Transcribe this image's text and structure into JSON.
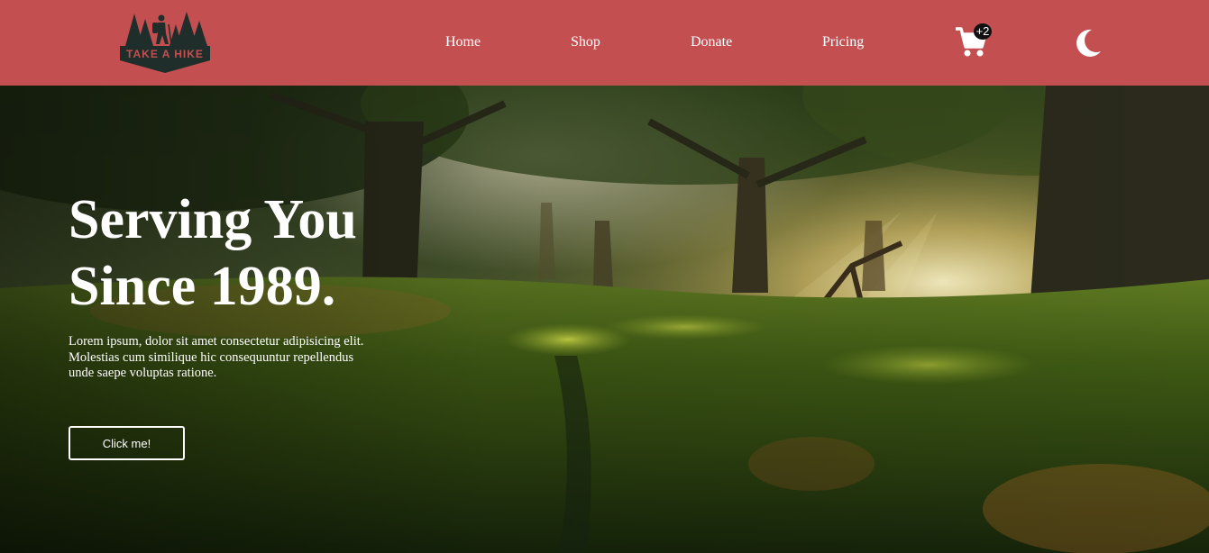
{
  "brand": {
    "logo_text": "TAKE A HIKE",
    "color": "#c44f51"
  },
  "nav": {
    "items": [
      {
        "label": "Home"
      },
      {
        "label": "Shop"
      },
      {
        "label": "Donate"
      },
      {
        "label": "Pricing"
      }
    ],
    "cart": {
      "icon": "cart-icon",
      "badge": "+2"
    },
    "theme_toggle": {
      "icon": "moon-icon"
    }
  },
  "hero": {
    "title_line1": "Serving You",
    "title_line2": "Since 1989.",
    "description": "Lorem ipsum, dolor sit amet consectetur adipisicing elit. Molestias cum similique hic consequuntur repellendus unde saepe voluptas ratione.",
    "button_label": "Click me!",
    "background": "forest-sunlight-image"
  }
}
